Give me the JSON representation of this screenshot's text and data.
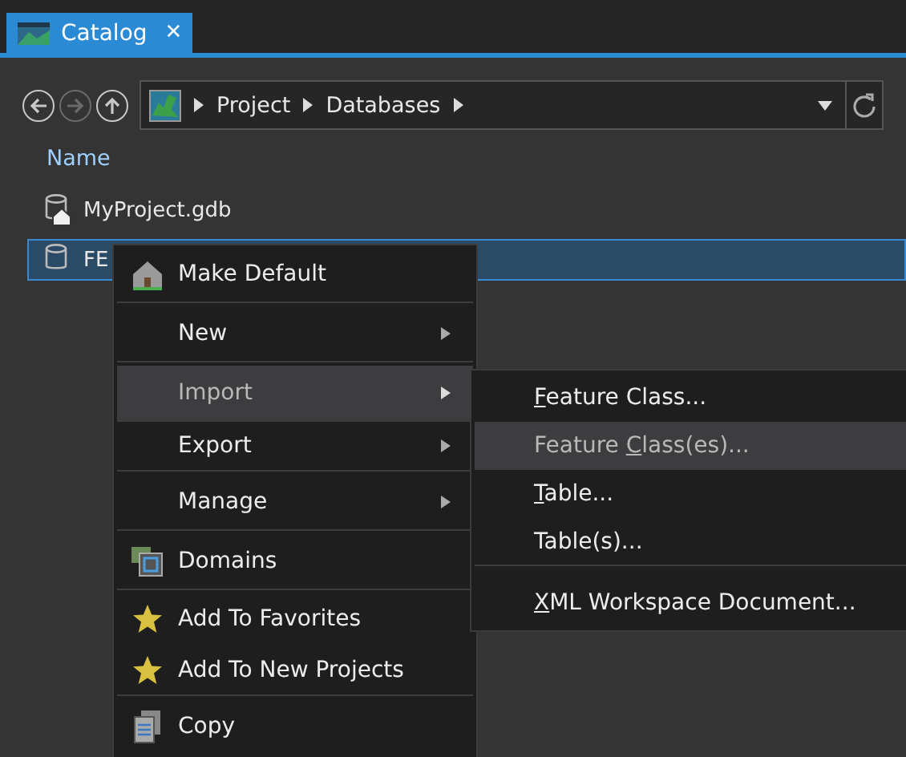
{
  "tab": {
    "title": "Catalog",
    "close": "✕",
    "selected": true
  },
  "breadcrumb": [
    "Project",
    "Databases"
  ],
  "column_header": "Name",
  "items": [
    {
      "name": "MyProject.gdb",
      "kind": "home",
      "selected": false
    },
    {
      "name": "FE",
      "kind": "plain",
      "selected": true
    }
  ],
  "context_menu": [
    {
      "label": "Make Default",
      "kind": "house",
      "submenu": false,
      "highlighted": false,
      "separator_after": true
    },
    {
      "label": "New",
      "kind": "plain",
      "submenu": true,
      "highlighted": false,
      "separator_after": true
    },
    {
      "label": "Import",
      "kind": "plain",
      "submenu": true,
      "highlighted": true,
      "separator_after": false
    },
    {
      "label": "Export",
      "kind": "plain",
      "submenu": true,
      "highlighted": false,
      "separator_after": true
    },
    {
      "label": "Manage",
      "kind": "plain",
      "submenu": true,
      "highlighted": false,
      "separator_after": true
    },
    {
      "label": "Domains",
      "kind": "domains",
      "submenu": false,
      "highlighted": false,
      "separator_after": true
    },
    {
      "label": "Add To Favorites",
      "kind": "star",
      "submenu": false,
      "highlighted": false,
      "separator_after": false
    },
    {
      "label": "Add To New Projects",
      "kind": "star",
      "submenu": false,
      "highlighted": false,
      "separator_after": true
    },
    {
      "label": "Copy",
      "kind": "copy",
      "submenu": false,
      "highlighted": false,
      "separator_after": false
    }
  ],
  "submenu": [
    {
      "key": "F",
      "post": "eature Class...",
      "highlighted": false,
      "separator_after": false
    },
    {
      "pre": "Feature ",
      "key": "C",
      "post": "lass(es)...",
      "highlighted": true,
      "separator_after": false
    },
    {
      "key": "T",
      "post": "able...",
      "highlighted": false,
      "separator_after": false
    },
    {
      "post": "Table(s)...",
      "highlighted": false,
      "separator_after": true
    },
    {
      "key": "X",
      "post": "ML Workspace Document...",
      "highlighted": false,
      "separator_after": false
    }
  ]
}
